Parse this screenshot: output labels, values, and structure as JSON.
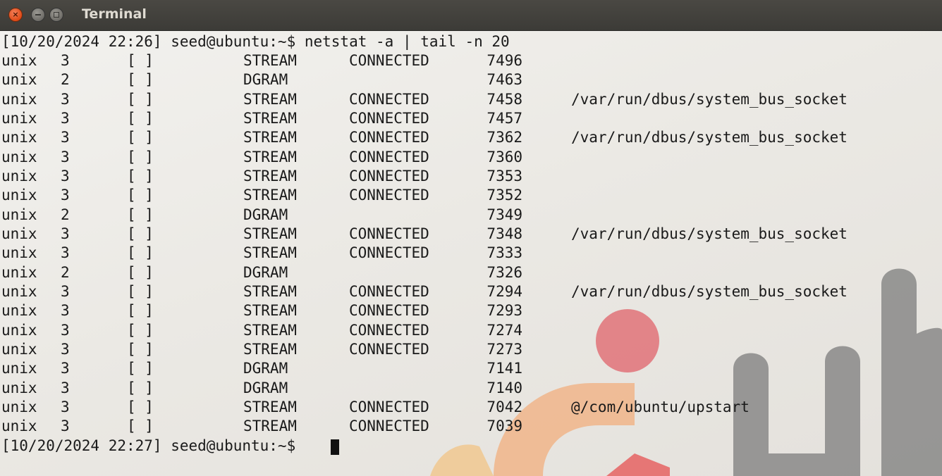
{
  "window": {
    "title": "Terminal",
    "close_glyph": "×"
  },
  "terminal": {
    "command_line": "[10/20/2024 22:26] seed@ubuntu:~$ netstat -a | tail -n 20",
    "rows": [
      {
        "proto": "unix",
        "refcnt": "3",
        "flags": "[ ]",
        "type": "STREAM",
        "state": "CONNECTED",
        "inode": "7496",
        "path": ""
      },
      {
        "proto": "unix",
        "refcnt": "2",
        "flags": "[ ]",
        "type": "DGRAM",
        "state": "",
        "inode": "7463",
        "path": ""
      },
      {
        "proto": "unix",
        "refcnt": "3",
        "flags": "[ ]",
        "type": "STREAM",
        "state": "CONNECTED",
        "inode": "7458",
        "path": "/var/run/dbus/system_bus_socket"
      },
      {
        "proto": "unix",
        "refcnt": "3",
        "flags": "[ ]",
        "type": "STREAM",
        "state": "CONNECTED",
        "inode": "7457",
        "path": ""
      },
      {
        "proto": "unix",
        "refcnt": "3",
        "flags": "[ ]",
        "type": "STREAM",
        "state": "CONNECTED",
        "inode": "7362",
        "path": "/var/run/dbus/system_bus_socket"
      },
      {
        "proto": "unix",
        "refcnt": "3",
        "flags": "[ ]",
        "type": "STREAM",
        "state": "CONNECTED",
        "inode": "7360",
        "path": ""
      },
      {
        "proto": "unix",
        "refcnt": "3",
        "flags": "[ ]",
        "type": "STREAM",
        "state": "CONNECTED",
        "inode": "7353",
        "path": ""
      },
      {
        "proto": "unix",
        "refcnt": "3",
        "flags": "[ ]",
        "type": "STREAM",
        "state": "CONNECTED",
        "inode": "7352",
        "path": ""
      },
      {
        "proto": "unix",
        "refcnt": "2",
        "flags": "[ ]",
        "type": "DGRAM",
        "state": "",
        "inode": "7349",
        "path": ""
      },
      {
        "proto": "unix",
        "refcnt": "3",
        "flags": "[ ]",
        "type": "STREAM",
        "state": "CONNECTED",
        "inode": "7348",
        "path": "/var/run/dbus/system_bus_socket"
      },
      {
        "proto": "unix",
        "refcnt": "3",
        "flags": "[ ]",
        "type": "STREAM",
        "state": "CONNECTED",
        "inode": "7333",
        "path": ""
      },
      {
        "proto": "unix",
        "refcnt": "2",
        "flags": "[ ]",
        "type": "DGRAM",
        "state": "",
        "inode": "7326",
        "path": ""
      },
      {
        "proto": "unix",
        "refcnt": "3",
        "flags": "[ ]",
        "type": "STREAM",
        "state": "CONNECTED",
        "inode": "7294",
        "path": "/var/run/dbus/system_bus_socket"
      },
      {
        "proto": "unix",
        "refcnt": "3",
        "flags": "[ ]",
        "type": "STREAM",
        "state": "CONNECTED",
        "inode": "7293",
        "path": ""
      },
      {
        "proto": "unix",
        "refcnt": "3",
        "flags": "[ ]",
        "type": "STREAM",
        "state": "CONNECTED",
        "inode": "7274",
        "path": ""
      },
      {
        "proto": "unix",
        "refcnt": "3",
        "flags": "[ ]",
        "type": "STREAM",
        "state": "CONNECTED",
        "inode": "7273",
        "path": ""
      },
      {
        "proto": "unix",
        "refcnt": "3",
        "flags": "[ ]",
        "type": "DGRAM",
        "state": "",
        "inode": "7141",
        "path": ""
      },
      {
        "proto": "unix",
        "refcnt": "3",
        "flags": "[ ]",
        "type": "DGRAM",
        "state": "",
        "inode": "7140",
        "path": ""
      },
      {
        "proto": "unix",
        "refcnt": "3",
        "flags": "[ ]",
        "type": "STREAM",
        "state": "CONNECTED",
        "inode": "7042",
        "path": "@/com/ubuntu/upstart"
      },
      {
        "proto": "unix",
        "refcnt": "3",
        "flags": "[ ]",
        "type": "STREAM",
        "state": "CONNECTED",
        "inode": "7039",
        "path": ""
      }
    ],
    "final_prompt": "[10/20/2024 22:27] seed@ubuntu:~$ "
  },
  "colors": {
    "titlebar": "#3c3b37",
    "terminal_bg": "#efeeeb",
    "text": "#1a1a1a",
    "close_button": "#df4a16"
  }
}
